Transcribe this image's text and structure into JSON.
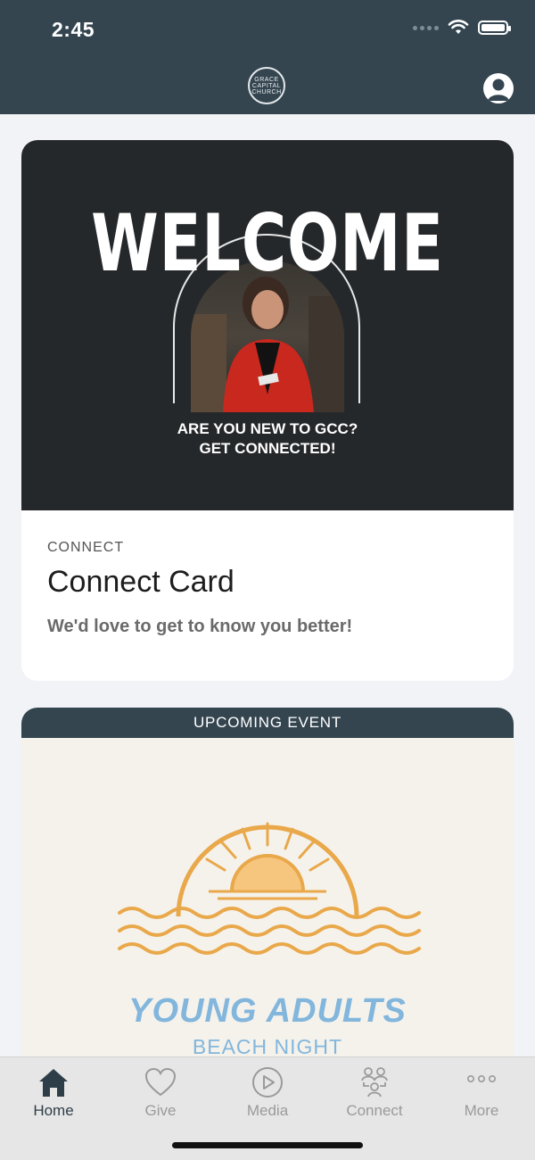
{
  "status_bar": {
    "time": "2:45"
  },
  "header": {
    "logo_lines": [
      "GRACE",
      "CAPITAL",
      "CHURCH"
    ]
  },
  "connect_card": {
    "hero_title": "WELCOME",
    "hero_line1": "ARE YOU NEW TO GCC?",
    "hero_line2": "GET CONNECTED!",
    "kicker": "CONNECT",
    "title": "Connect Card",
    "description": "We'd love to get to know you better!"
  },
  "event_card": {
    "badge": "UPCOMING EVENT",
    "art_title": "YOUNG ADULTS",
    "art_subtitle": "BEACH NIGHT"
  },
  "tabs": [
    {
      "label": "Home",
      "icon": "home-icon",
      "active": true
    },
    {
      "label": "Give",
      "icon": "heart-icon",
      "active": false
    },
    {
      "label": "Media",
      "icon": "play-icon",
      "active": false
    },
    {
      "label": "Connect",
      "icon": "people-icon",
      "active": false
    },
    {
      "label": "More",
      "icon": "more-icon",
      "active": false
    }
  ],
  "colors": {
    "header_bg": "#344550",
    "active_tab": "#2e3e48",
    "inactive_tab": "#9a9a9a",
    "sun_orange": "#e9a84a",
    "beach_blue": "#82b6dc"
  }
}
